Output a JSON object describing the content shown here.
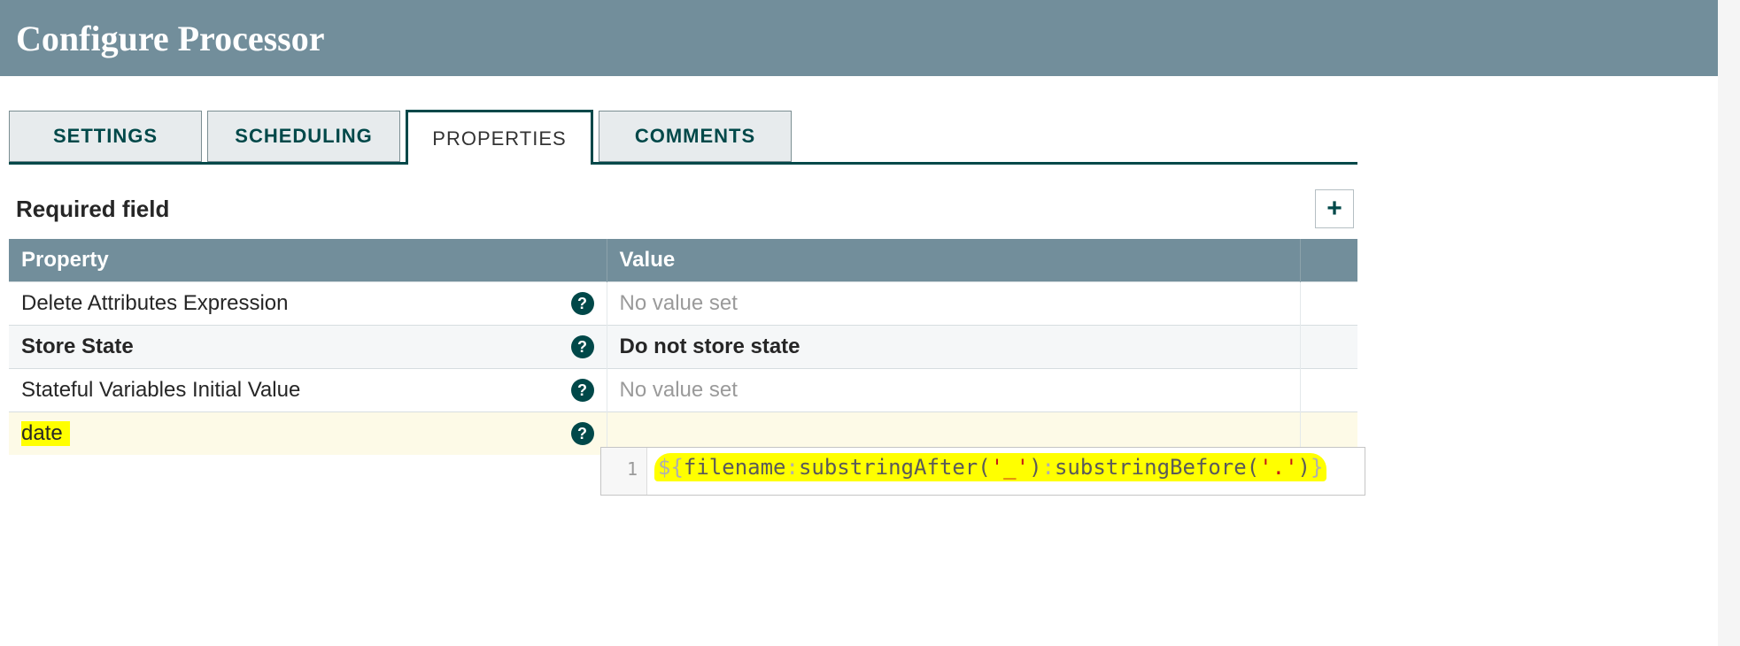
{
  "header": {
    "title": "Configure Processor"
  },
  "tabs": {
    "items": [
      "SETTINGS",
      "SCHEDULING",
      "PROPERTIES",
      "COMMENTS"
    ],
    "activeIndex": 2
  },
  "panel": {
    "required_label": "Required field",
    "add_button_title": "Add Property",
    "columns": {
      "property": "Property",
      "value": "Value"
    },
    "rows": [
      {
        "name": "Delete Attributes Expression",
        "bold": false,
        "value": null,
        "placeholder": "No value set",
        "highlighted": false,
        "alt": false
      },
      {
        "name": "Store State",
        "bold": true,
        "value": "Do not store state",
        "placeholder": null,
        "highlighted": false,
        "alt": true
      },
      {
        "name": "Stateful Variables Initial Value",
        "bold": false,
        "value": null,
        "placeholder": "No value set",
        "highlighted": false,
        "alt": false
      },
      {
        "name": "date",
        "bold": false,
        "value": null,
        "placeholder": null,
        "highlighted": true,
        "alt": false
      }
    ],
    "help_tooltip": "Help"
  },
  "editor": {
    "line_number": "1",
    "expression_display": "${filename:substringAfter('_'):substringBefore('.')}",
    "parts": {
      "open": "${",
      "var": "filename",
      "sep1": ":",
      "fn1": "substringAfter",
      "arg1_open": "(",
      "arg1_q": "'",
      "arg1": "_",
      "arg1_close": ")",
      "sep2": ":",
      "fn2": "substringBefore",
      "arg2_open": "(",
      "arg2_q": "'",
      "arg2": ".",
      "arg2_close": ")",
      "close": "}"
    }
  }
}
